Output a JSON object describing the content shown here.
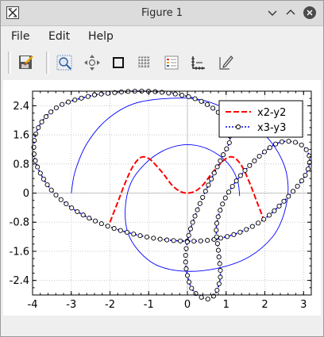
{
  "window": {
    "title": "Figure 1"
  },
  "menu": {
    "items": [
      "File",
      "Edit",
      "Help"
    ]
  },
  "toolbar": {
    "tools": [
      "save-icon",
      "zoom-icon",
      "pan-icon",
      "square-icon",
      "grid-icon",
      "legend-icon",
      "axes-icon",
      "edit-icon"
    ]
  },
  "chart_data": {
    "type": "line",
    "title": "",
    "xlabel": "",
    "ylabel": "",
    "xlim": [
      -4,
      3.2
    ],
    "ylim": [
      -2.8,
      2.8
    ],
    "xticks": [
      "-4",
      "-3",
      "-2",
      "-1",
      "0",
      "1",
      "2",
      "3"
    ],
    "yticks": [
      "2.4",
      "1.6",
      "0.8",
      "0",
      "-0.8",
      "-1.6",
      "-2.4"
    ],
    "grid": true,
    "legend": {
      "position": "top-right",
      "entries": [
        "x2-y2",
        "x3-y3"
      ]
    },
    "series": [
      {
        "name": "",
        "color": "#0000ff",
        "style": "solid thin",
        "equation_shape": "spiral",
        "points": [
          [
            -3.0,
            0.0
          ],
          [
            -2.9,
            0.6
          ],
          [
            -2.6,
            1.35
          ],
          [
            -2.1,
            2.0
          ],
          [
            -1.4,
            2.45
          ],
          [
            -0.5,
            2.6
          ],
          [
            0.4,
            2.55
          ],
          [
            1.3,
            2.15
          ],
          [
            2.0,
            1.6
          ],
          [
            2.45,
            0.9
          ],
          [
            2.6,
            0.2
          ],
          [
            2.5,
            -0.55
          ],
          [
            2.2,
            -1.2
          ],
          [
            1.6,
            -1.75
          ],
          [
            0.85,
            -2.05
          ],
          [
            0.0,
            -2.15
          ],
          [
            -0.75,
            -2.0
          ],
          [
            -1.25,
            -1.6
          ],
          [
            -1.55,
            -1.05
          ],
          [
            -1.6,
            -0.35
          ],
          [
            -1.45,
            0.3
          ],
          [
            -1.1,
            0.8
          ],
          [
            -0.65,
            1.15
          ],
          [
            -0.15,
            1.32
          ],
          [
            0.35,
            1.28
          ],
          [
            0.8,
            1.05
          ],
          [
            1.12,
            0.72
          ],
          [
            1.3,
            0.32
          ],
          [
            1.35,
            -0.08
          ]
        ]
      },
      {
        "name": "x2-y2",
        "color": "#ff0000",
        "style": "dashed",
        "points": [
          [
            -2.0,
            -0.8
          ],
          [
            -1.8,
            -0.25
          ],
          [
            -1.6,
            0.3
          ],
          [
            -1.4,
            0.75
          ],
          [
            -1.2,
            0.98
          ],
          [
            -1.0,
            0.95
          ],
          [
            -0.8,
            0.75
          ],
          [
            -0.6,
            0.5
          ],
          [
            -0.4,
            0.22
          ],
          [
            -0.2,
            0.05
          ],
          [
            0.0,
            0.0
          ],
          [
            0.2,
            0.05
          ],
          [
            0.4,
            0.22
          ],
          [
            0.6,
            0.5
          ],
          [
            0.8,
            0.75
          ],
          [
            1.0,
            0.95
          ],
          [
            1.2,
            0.98
          ],
          [
            1.4,
            0.75
          ],
          [
            1.6,
            0.3
          ],
          [
            1.8,
            -0.25
          ],
          [
            2.0,
            -0.8
          ]
        ]
      },
      {
        "name": "x3-y3",
        "color": "#0000ff",
        "style": "dotted with circle markers",
        "marker": "circle",
        "points": [
          [
            -2.4,
            2.7
          ],
          [
            -3.3,
            2.4
          ],
          [
            -3.85,
            1.8
          ],
          [
            -3.95,
            1.0
          ],
          [
            -3.6,
            0.2
          ],
          [
            -3.0,
            -0.4
          ],
          [
            -2.2,
            -0.85
          ],
          [
            -1.3,
            -1.15
          ],
          [
            -0.4,
            -1.3
          ],
          [
            0.5,
            -1.3
          ],
          [
            1.3,
            -1.1
          ],
          [
            2.0,
            -0.7
          ],
          [
            2.6,
            -0.1
          ],
          [
            3.05,
            0.5
          ],
          [
            3.15,
            1.0
          ],
          [
            2.9,
            1.35
          ],
          [
            2.4,
            1.4
          ],
          [
            1.9,
            1.05
          ],
          [
            1.35,
            0.45
          ],
          [
            0.95,
            -0.2
          ],
          [
            0.75,
            -0.9
          ],
          [
            0.8,
            -1.6
          ],
          [
            0.85,
            -2.3
          ],
          [
            0.7,
            -2.8
          ],
          [
            0.45,
            -2.9
          ],
          [
            0.1,
            -2.6
          ],
          [
            -0.05,
            -1.85
          ],
          [
            0.05,
            -1.1
          ],
          [
            0.3,
            -0.35
          ],
          [
            0.6,
            0.35
          ],
          [
            0.9,
            1.0
          ],
          [
            1.1,
            1.5
          ],
          [
            0.9,
            2.1
          ],
          [
            0.3,
            2.55
          ],
          [
            -0.5,
            2.75
          ],
          [
            -1.4,
            2.8
          ],
          [
            -2.4,
            2.7
          ]
        ]
      }
    ]
  }
}
